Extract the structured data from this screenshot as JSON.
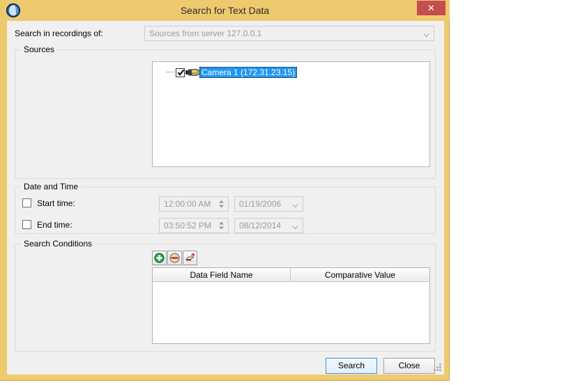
{
  "window": {
    "title": "Search for Text Data",
    "app_icon": "app-shield-icon",
    "close_label": "✕",
    "frame_color": "#eeca6e",
    "close_button_color": "#c64d4d"
  },
  "top_row": {
    "label": "Search in recordings of:",
    "source_select": {
      "value": "Sources from server 127.0.0.1",
      "disabled": true,
      "arrow_icon": "chevron-down-icon"
    }
  },
  "sources_group": {
    "title": "Sources",
    "tree": [
      {
        "label": "Camera 1 (172.31.23.15)",
        "checked": true,
        "selected": true,
        "icon": "camera-icon",
        "selection_color": "#2196f3"
      }
    ]
  },
  "datetime_group": {
    "title": "Date and Time",
    "rows": [
      {
        "checkbox_label": "Start time:",
        "checked": false,
        "time_value": "12:00:00 AM",
        "date_value": "01/19/2006",
        "disabled": true
      },
      {
        "checkbox_label": "End time:",
        "checked": false,
        "time_value": "03:50:52 PM",
        "date_value": "08/12/2014",
        "disabled": true
      }
    ]
  },
  "conditions_group": {
    "title": "Search Conditions",
    "toolbar": [
      {
        "name": "add-condition-button",
        "icon": "plus-circle-icon",
        "color": "#118a3c"
      },
      {
        "name": "remove-condition-button",
        "icon": "minus-circle-icon",
        "color": "#cc2222"
      },
      {
        "name": "clear-conditions-button",
        "icon": "eraser-icon",
        "color": "#cc2222"
      }
    ],
    "columns": [
      "Data Field Name",
      "Comparative Value"
    ],
    "rows": []
  },
  "footer": {
    "search_label": "Search",
    "close_label": "Close",
    "default_button_color": "#3c8ddc"
  }
}
